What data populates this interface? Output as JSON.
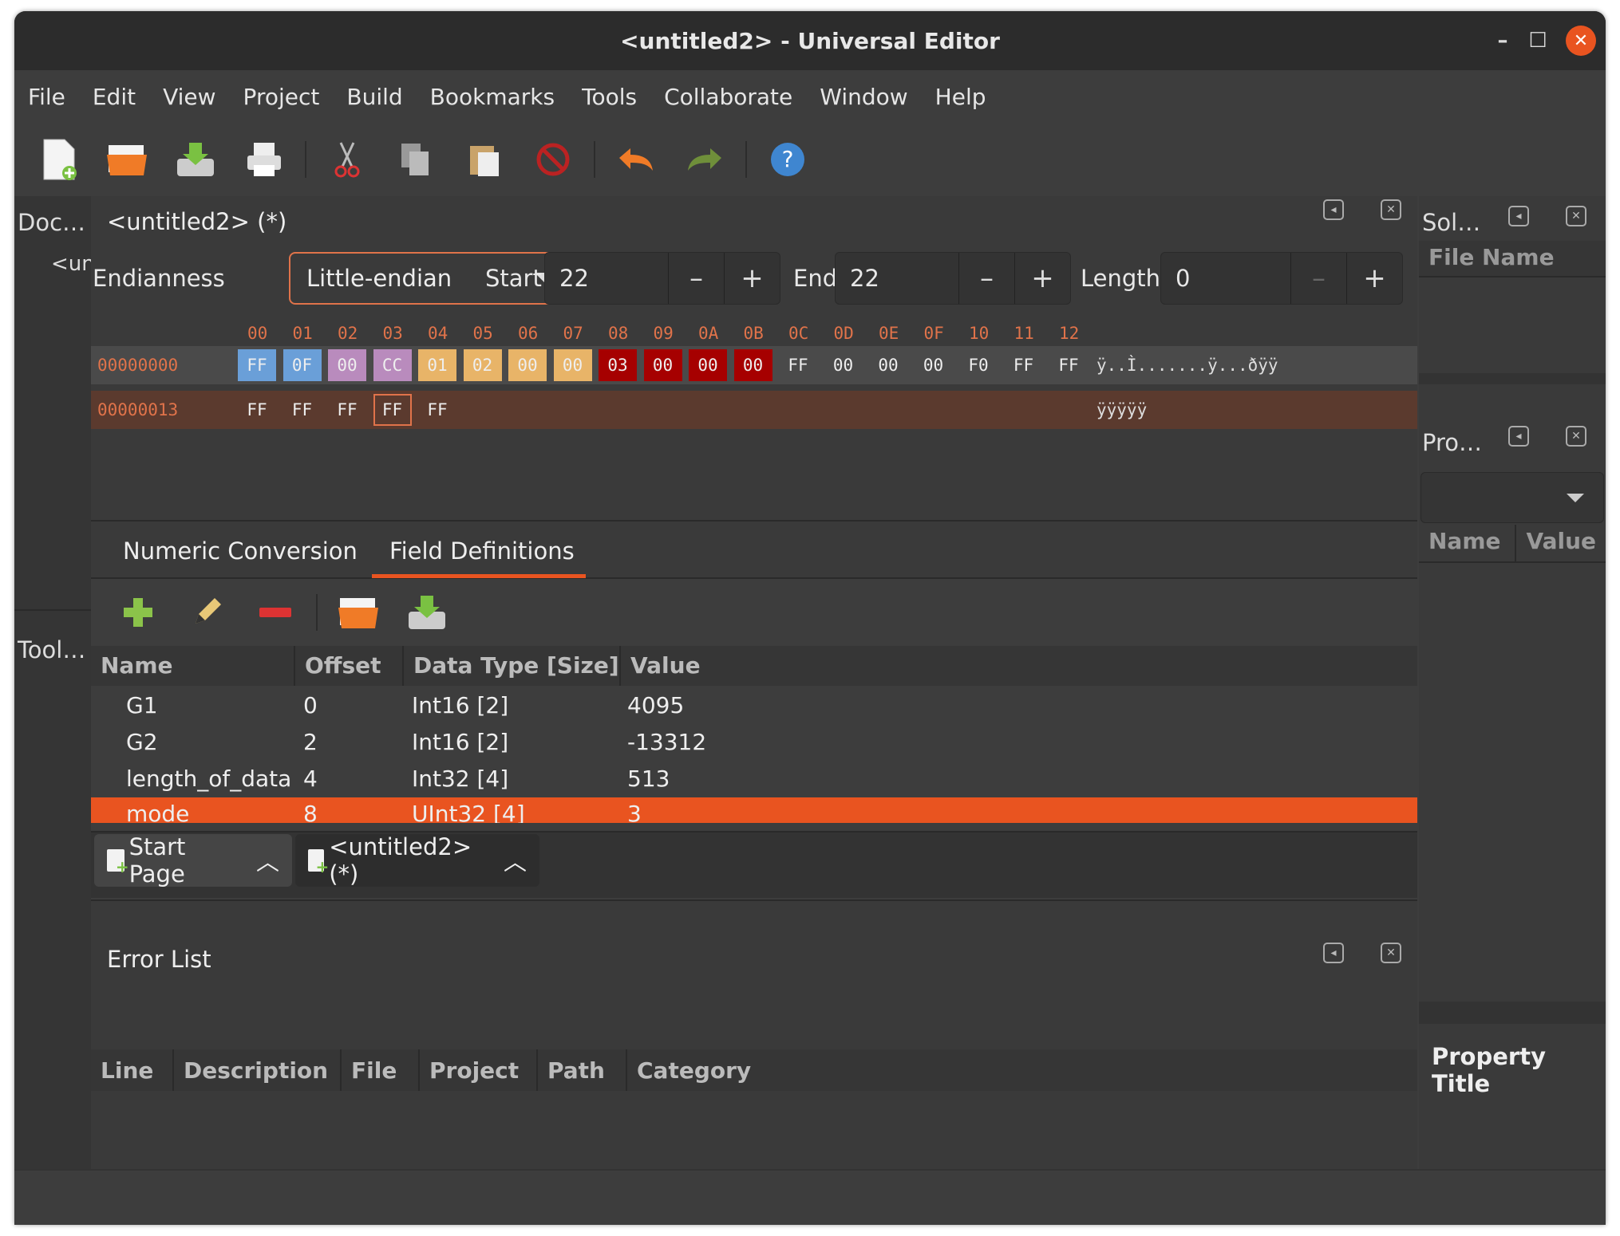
{
  "window": {
    "title": "<untitled2> - Universal Editor",
    "minimize": "–",
    "maximize": "☐",
    "close": "✕"
  },
  "menu": [
    "File",
    "Edit",
    "View",
    "Project",
    "Build",
    "Bookmarks",
    "Tools",
    "Collaborate",
    "Window",
    "Help"
  ],
  "left_panel": {
    "doc_title": "Doc…",
    "doc_item": "<un",
    "tools_title": "Tool…"
  },
  "document": {
    "title": "<untitled2> (*)"
  },
  "controls": {
    "endianness_label": "Endianness",
    "endianness_value": "Little-endian",
    "start_label": "Start",
    "start_value": "22",
    "end_label": "End",
    "end_value": "22",
    "length_label": "Length",
    "length_value": "0",
    "minus": "–",
    "plus": "+"
  },
  "hex": {
    "columns": [
      "00",
      "01",
      "02",
      "03",
      "04",
      "05",
      "06",
      "07",
      "08",
      "09",
      "0A",
      "0B",
      "0C",
      "0D",
      "0E",
      "0F",
      "10",
      "11",
      "12"
    ],
    "rows": [
      {
        "offset": "00000000",
        "bytes": [
          "FF",
          "0F",
          "00",
          "CC",
          "01",
          "02",
          "00",
          "00",
          "03",
          "00",
          "00",
          "00",
          "FF",
          "00",
          "00",
          "00",
          "F0",
          "FF",
          "FF"
        ],
        "ascii": "ÿ..Ì.......ÿ...ðÿÿ"
      },
      {
        "offset": "00000013",
        "bytes": [
          "FF",
          "FF",
          "FF",
          "FF",
          "FF"
        ],
        "ascii": "ÿÿÿÿÿ"
      }
    ],
    "colors": {
      "g1": "#6a9fd8",
      "g2": "#b98bbd",
      "len": "#e8b468",
      "mode": "#a60000",
      "cursor": "#e0734a",
      "sel_row": "#5b3a2e"
    }
  },
  "tabs": [
    "Numeric Conversion",
    "Field Definitions"
  ],
  "field_table": {
    "headers": [
      "Name",
      "Offset",
      "Data Type [Size]",
      "Value"
    ],
    "rows": [
      {
        "name": "G1",
        "offset": "0",
        "type": "Int16 [2]",
        "value": "4095"
      },
      {
        "name": "G2",
        "offset": "2",
        "type": "Int16 [2]",
        "value": "-13312"
      },
      {
        "name": "length_of_data",
        "offset": "4",
        "type": "Int32 [4]",
        "value": "513"
      },
      {
        "name": "mode",
        "offset": "8",
        "type": "UInt32 [4]",
        "value": "3"
      }
    ]
  },
  "doc_tabs": [
    "Start Page",
    "<untitled2> (*)"
  ],
  "error_list": {
    "title": "Error List",
    "headers": [
      "Line",
      "Description",
      "File",
      "Project",
      "Path",
      "Category"
    ]
  },
  "right_panel": {
    "solution_title": "Sol…",
    "file_name_header": "File Name",
    "properties_title": "Pro…",
    "name_header": "Name",
    "value_header": "Value",
    "property_title": "Property Title"
  }
}
